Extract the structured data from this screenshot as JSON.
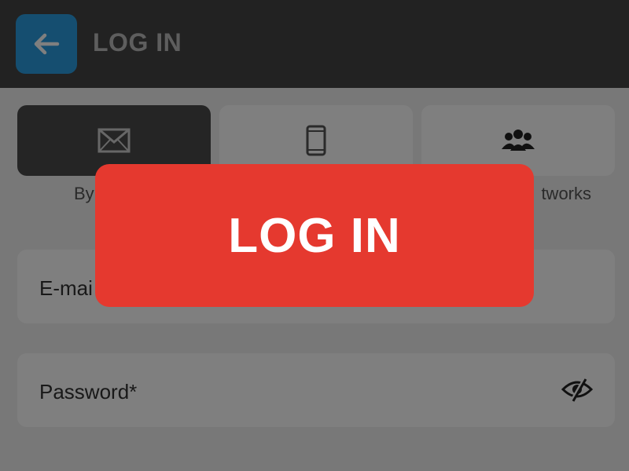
{
  "header": {
    "title": "LOG IN",
    "back_icon": "arrow-left-icon"
  },
  "tabs": [
    {
      "icon": "envelope-icon",
      "label": "By",
      "active": true
    },
    {
      "icon": "smartphone-icon",
      "label": "",
      "active": false
    },
    {
      "icon": "users-icon",
      "label": "tworks",
      "active": false
    }
  ],
  "form": {
    "email_placeholder": "E-mai",
    "password_placeholder": "Password*",
    "password_toggle_icon": "eye-slash-icon"
  },
  "overlay": {
    "button_label": "LOG IN"
  },
  "colors": {
    "header_bg": "#444444",
    "back_button": "#2b9ce0",
    "active_tab": "#4a4a4a",
    "login_button": "#e5392f"
  }
}
